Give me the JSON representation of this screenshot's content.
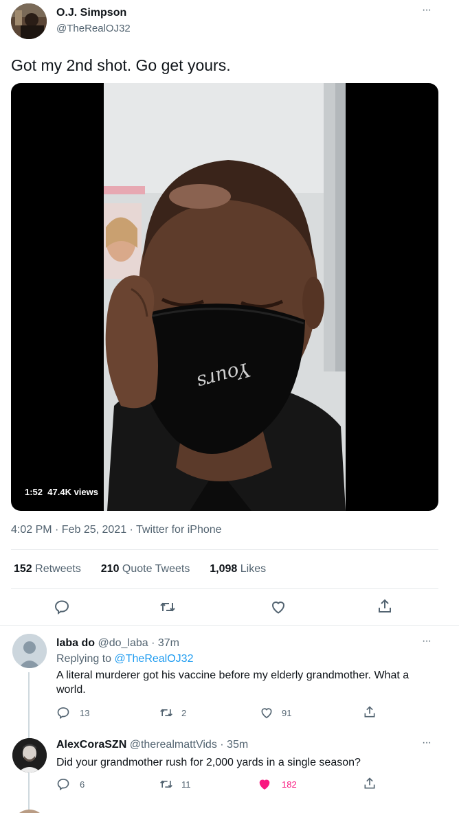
{
  "tweet": {
    "author_name": "O.J. Simpson",
    "author_handle": "@TheRealOJ32",
    "more_glyph": "···",
    "text": "Got my 2nd shot. Go get yours.",
    "video": {
      "duration": "1:52",
      "views": "47.4K views",
      "mask_text": "Yours"
    },
    "timestamp": "4:02 PM · Feb 25, 2021 · Twitter for iPhone",
    "stats": {
      "retweets_count": "152",
      "retweets_label": "Retweets",
      "quotes_count": "210",
      "quotes_label": "Quote Tweets",
      "likes_count": "1,098",
      "likes_label": "Likes"
    }
  },
  "replies": [
    {
      "name": "laba do",
      "handle": "@do_laba",
      "time": "· 37m",
      "replying_prefix": "Replying to",
      "replying_handle": "@TheRealOJ32",
      "text": "A literal murderer got his vaccine before my elderly grandmother. What a world.",
      "reply_count": "13",
      "retweet_count": "2",
      "like_count": "91",
      "liked": false
    },
    {
      "name": "AlexCoraSZN",
      "handle": "@therealmattVids",
      "time": "· 35m",
      "text": "Did your grandmother rush for 2,000 yards in a single season?",
      "reply_count": "6",
      "retweet_count": "11",
      "like_count": "182",
      "liked": true
    }
  ],
  "colors": {
    "text": "#0f1419",
    "muted": "#536471",
    "link": "#1d9bf0",
    "like_active": "#f91880",
    "divider": "#e6e9eb"
  }
}
